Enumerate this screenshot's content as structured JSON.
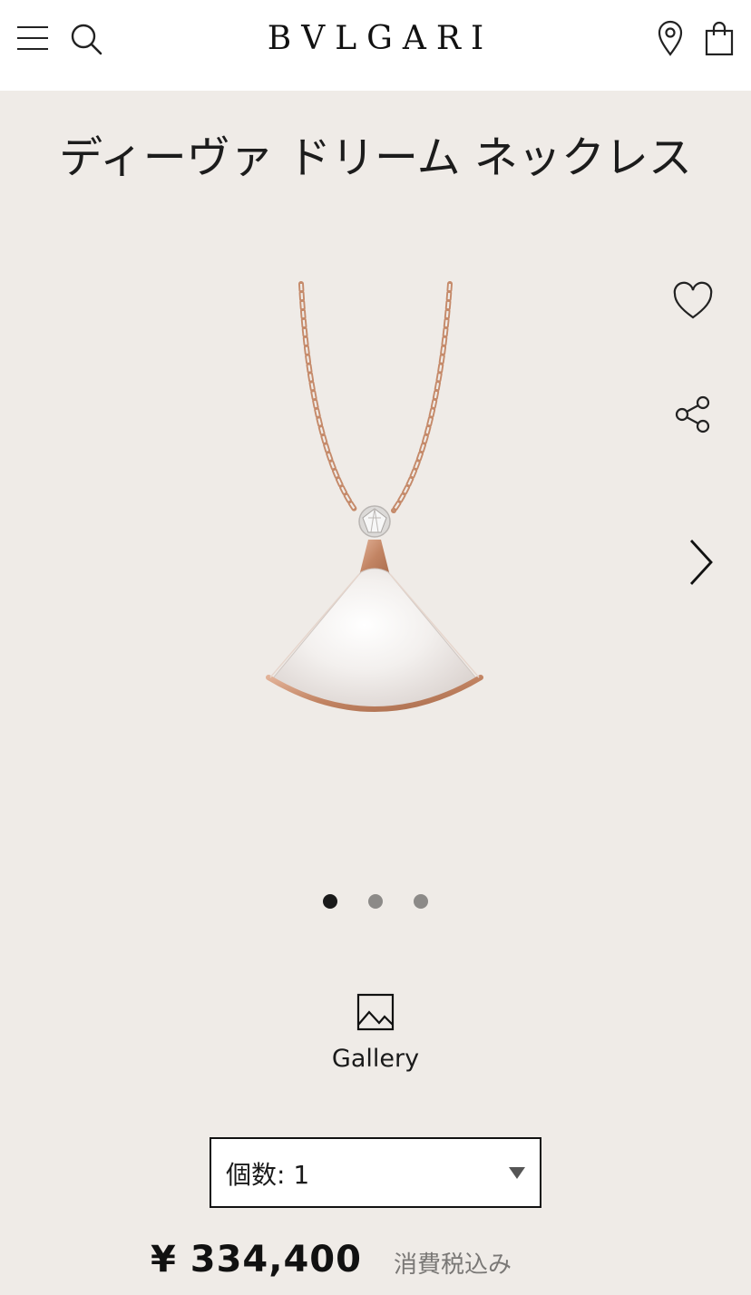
{
  "header": {
    "logo": "BVLGARI",
    "icons": {
      "menu": "hamburger-menu-icon",
      "search": "search-icon",
      "location": "location-pin-icon",
      "cart": "shopping-bag-icon"
    }
  },
  "product": {
    "title": "ディーヴァ ドリーム ネックレス",
    "image_alt": "necklace-image",
    "actions": {
      "wishlist": "heart-icon",
      "share": "share-icon",
      "next": "chevron-right-icon"
    },
    "carousel": {
      "total": 3,
      "active": 1
    },
    "gallery_label": "Gallery",
    "quantity_label": "個数: 1",
    "price": "¥ 334,400",
    "tax_note": "消費税込み"
  },
  "colors": {
    "background": "#efebe7",
    "header": "#ffffff",
    "gold": "#c58a6a",
    "text": "#1a1a1a"
  }
}
